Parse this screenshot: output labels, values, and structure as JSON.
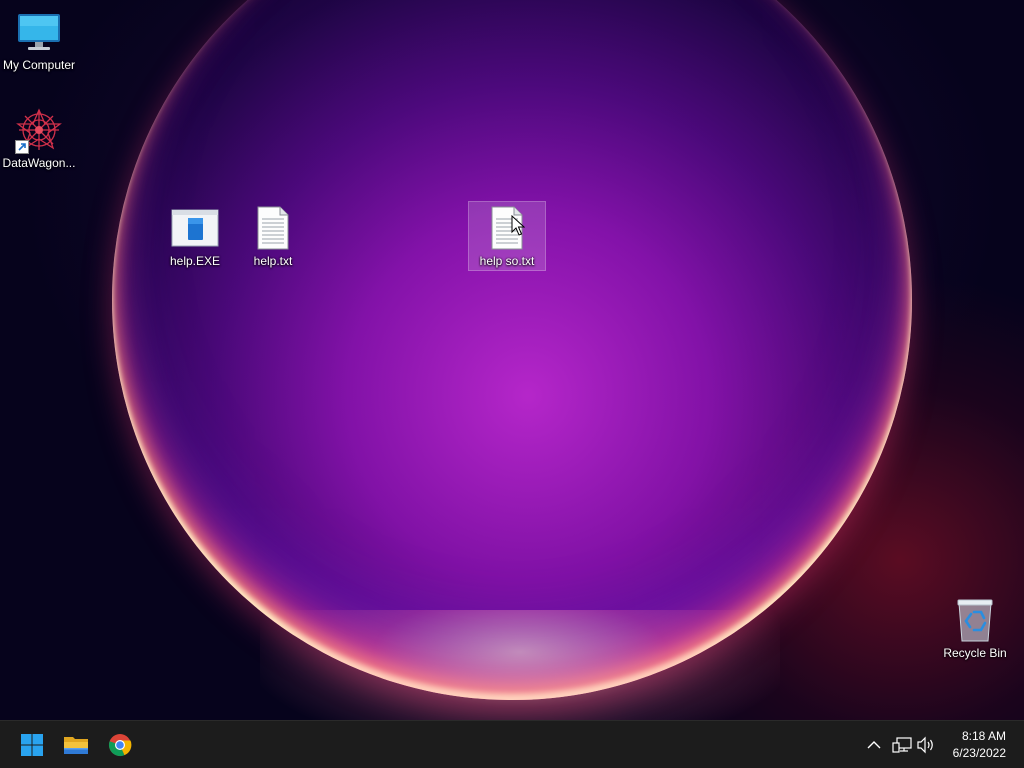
{
  "desktop": {
    "icons": [
      {
        "label": "My Computer",
        "icon": "monitor-icon"
      },
      {
        "label": "DataWagon...",
        "icon": "datawagon-logo-icon"
      },
      {
        "label": "help.EXE",
        "icon": "executable-window-icon"
      },
      {
        "label": "help.txt",
        "icon": "text-document-icon"
      },
      {
        "label": "help so.txt",
        "icon": "text-document-icon"
      },
      {
        "label": "Recycle Bin",
        "icon": "recycle-bin-icon"
      }
    ]
  },
  "taskbar": {
    "pinned": [
      {
        "name": "start-button",
        "icon": "windows-logo-icon"
      },
      {
        "name": "file-explorer-button",
        "icon": "folder-icon"
      },
      {
        "name": "chrome-button",
        "icon": "chrome-icon"
      }
    ],
    "tray": {
      "icons": [
        "chevron-up-icon",
        "network-icon",
        "volume-icon"
      ],
      "time": "8:18 AM",
      "date": "6/23/2022"
    }
  },
  "colors": {
    "taskbar_bg": "#1c1c1c",
    "windows_blue": "#29a3ef",
    "folder_yellow": "#f3c23c"
  }
}
